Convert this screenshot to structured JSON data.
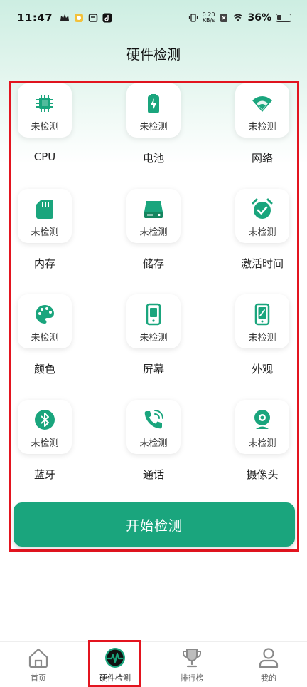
{
  "status_bar": {
    "time": "11:47",
    "net_speed_value": "0.20",
    "net_speed_unit": "KB/s",
    "battery": "36%"
  },
  "header": {
    "title": "硬件检测"
  },
  "colors": {
    "accent": "#1aa57d",
    "highlight": "#e3141f"
  },
  "items": [
    {
      "label": "CPU",
      "status": "未检测",
      "icon": "cpu-icon"
    },
    {
      "label": "电池",
      "status": "未检测",
      "icon": "battery-icon"
    },
    {
      "label": "网络",
      "status": "未检测",
      "icon": "wifi-icon"
    },
    {
      "label": "内存",
      "status": "未检测",
      "icon": "memory-card-icon"
    },
    {
      "label": "储存",
      "status": "未检测",
      "icon": "storage-drive-icon"
    },
    {
      "label": "激活时间",
      "status": "未检测",
      "icon": "alarm-clock-icon"
    },
    {
      "label": "颜色",
      "status": "未检测",
      "icon": "palette-icon"
    },
    {
      "label": "屏幕",
      "status": "未检测",
      "icon": "screen-icon"
    },
    {
      "label": "外观",
      "status": "未检测",
      "icon": "phone-appearance-icon"
    },
    {
      "label": "蓝牙",
      "status": "未检测",
      "icon": "bluetooth-icon"
    },
    {
      "label": "通话",
      "status": "未检测",
      "icon": "phone-call-icon"
    },
    {
      "label": "摄像头",
      "status": "未检测",
      "icon": "webcam-icon"
    }
  ],
  "start_button": {
    "label": "开始检测"
  },
  "tabs": [
    {
      "label": "首页",
      "icon": "home-icon",
      "active": false
    },
    {
      "label": "硬件检测",
      "icon": "pulse-icon",
      "active": true
    },
    {
      "label": "排行榜",
      "icon": "trophy-icon",
      "active": false
    },
    {
      "label": "我的",
      "icon": "user-icon",
      "active": false
    }
  ]
}
